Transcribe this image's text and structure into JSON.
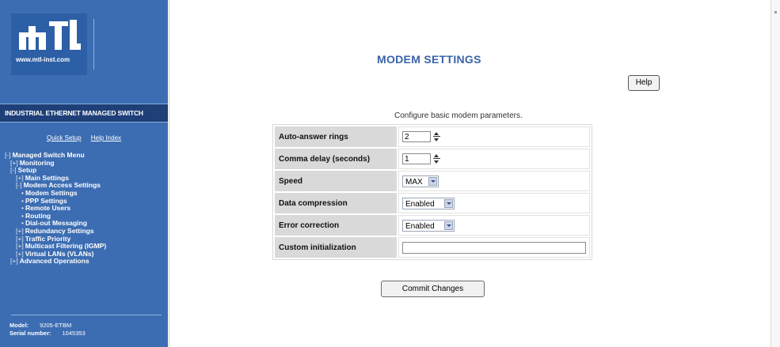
{
  "sidebar": {
    "logo_text": "mTL",
    "logo_url": "www.mtl-inst.com",
    "product_title": "INDUSTRIAL ETHERNET MANAGED SWITCH",
    "quick_links": [
      "Quick Setup",
      "Help Index"
    ],
    "nav": [
      {
        "prefix": "[-]",
        "label": "Managed Switch Menu",
        "indent": 0
      },
      {
        "prefix": "[+]",
        "label": "Monitoring",
        "indent": 1
      },
      {
        "prefix": "[-]",
        "label": "Setup",
        "indent": 1
      },
      {
        "prefix": "[+]",
        "label": "Main Settings",
        "indent": 2
      },
      {
        "prefix": "[-]",
        "label": "Modem Access Settings",
        "indent": 2
      },
      {
        "prefix": "•",
        "label": "Modem Settings",
        "indent": 3
      },
      {
        "prefix": "•",
        "label": "PPP Settings",
        "indent": 3
      },
      {
        "prefix": "•",
        "label": "Remote Users",
        "indent": 3
      },
      {
        "prefix": "•",
        "label": "Routing",
        "indent": 3
      },
      {
        "prefix": "•",
        "label": "Dial-out Messaging",
        "indent": 3
      },
      {
        "prefix": "[+]",
        "label": "Redundancy Settings",
        "indent": 2
      },
      {
        "prefix": "[+]",
        "label": "Traffic Priority",
        "indent": 2
      },
      {
        "prefix": "[+]",
        "label": "Multicast Filtering (IGMP)",
        "indent": 2
      },
      {
        "prefix": "[+]",
        "label": "Virtual LANs (VLANs)",
        "indent": 2
      },
      {
        "prefix": "[+]",
        "label": "Advanced Operations",
        "indent": 1
      }
    ],
    "device_info": [
      {
        "label": "Model:",
        "value": "9205-ETBM"
      },
      {
        "label": "Serial number:",
        "value": "1045353"
      }
    ]
  },
  "main": {
    "title": "MODEM SETTINGS",
    "help_label": "Help",
    "subtitle": "Configure basic modem parameters.",
    "fields": {
      "auto_answer": {
        "label": "Auto-answer rings",
        "value": "2"
      },
      "comma_delay": {
        "label": "Comma delay (seconds)",
        "value": "1"
      },
      "speed": {
        "label": "Speed",
        "value": "MAX"
      },
      "data_compression": {
        "label": "Data compression",
        "value": "Enabled"
      },
      "error_correction": {
        "label": "Error correction",
        "value": "Enabled"
      },
      "custom_init": {
        "label": "Custom initialization",
        "value": ""
      }
    },
    "commit_label": "Commit Changes"
  },
  "colors": {
    "sidebar_bg": "#3c6db2",
    "sidebar_title_bg": "#1f3f78",
    "title_blue": "#3a63a8",
    "label_cell_bg": "#d9d9d9"
  }
}
